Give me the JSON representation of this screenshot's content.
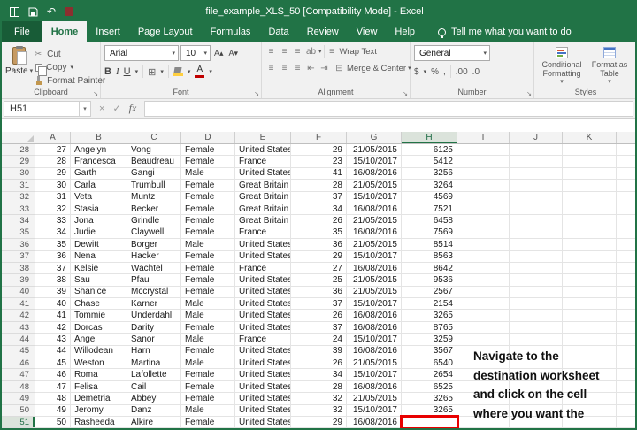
{
  "window": {
    "title": "file_example_XLS_50 [Compatibility Mode] - Excel"
  },
  "colors": {
    "titlebar_green": "#217346",
    "selection_box_red": "#e80000"
  },
  "icons": {
    "caret": "▾",
    "undo": "↶",
    "redo": "↷",
    "cut": "✂",
    "align": "≡",
    "borders": "⊞",
    "merge": "⊟",
    "cancel": "×",
    "enter": "✓",
    "fx": "fx",
    "launcher": "↘",
    "grow_font": "A▴",
    "shrink_font": "A▾",
    "font_color_letter": "A",
    "orientation": "ab",
    "indent_left": "⇤",
    "indent_right": "⇥"
  },
  "ribbon": {
    "tabs": [
      {
        "label": "File",
        "active": false
      },
      {
        "label": "Home",
        "active": true
      },
      {
        "label": "Insert",
        "active": false
      },
      {
        "label": "Page Layout",
        "active": false
      },
      {
        "label": "Formulas",
        "active": false
      },
      {
        "label": "Data",
        "active": false
      },
      {
        "label": "Review",
        "active": false
      },
      {
        "label": "View",
        "active": false
      },
      {
        "label": "Help",
        "active": false
      }
    ],
    "tell_me": "Tell me what you want to do",
    "clipboard": {
      "group_label": "Clipboard",
      "paste": "Paste",
      "cut": "Cut",
      "copy": "Copy",
      "format_painter": "Format Painter"
    },
    "font": {
      "group_label": "Font",
      "font_name": "Arial",
      "font_size": "10",
      "bold": "B",
      "italic": "I",
      "underline": "U"
    },
    "alignment": {
      "group_label": "Alignment",
      "wrap_text": "Wrap Text",
      "merge_center": "Merge & Center"
    },
    "number": {
      "group_label": "Number",
      "format": "General",
      "accounting": "$",
      "percent": "%",
      "comma": ",",
      "increase_decimal": ".00",
      "decrease_decimal": ".0"
    },
    "styles": {
      "group_label": "Styles",
      "conditional_formatting": "Conditional Formatting",
      "format_as_table": "Format as Table"
    }
  },
  "formula_bar": {
    "name_box": "H51",
    "formula": ""
  },
  "sheet": {
    "columns": [
      "A",
      "B",
      "C",
      "D",
      "E",
      "F",
      "G",
      "H",
      "I",
      "J",
      "K"
    ],
    "column_align": [
      "right",
      "left",
      "left",
      "left",
      "left",
      "right",
      "right",
      "right",
      "left",
      "left",
      "left"
    ],
    "selected": {
      "col": "H",
      "row": 51
    },
    "rows": [
      {
        "n": 28,
        "c": [
          "27",
          "Angelyn",
          "Vong",
          "Female",
          "United States",
          "29",
          "21/05/2015",
          "6125"
        ]
      },
      {
        "n": 29,
        "c": [
          "28",
          "Francesca",
          "Beaudreau",
          "Female",
          "France",
          "23",
          "15/10/2017",
          "5412"
        ]
      },
      {
        "n": 30,
        "c": [
          "29",
          "Garth",
          "Gangi",
          "Male",
          "United States",
          "41",
          "16/08/2016",
          "3256"
        ]
      },
      {
        "n": 31,
        "c": [
          "30",
          "Carla",
          "Trumbull",
          "Female",
          "Great Britain",
          "28",
          "21/05/2015",
          "3264"
        ]
      },
      {
        "n": 32,
        "c": [
          "31",
          "Veta",
          "Muntz",
          "Female",
          "Great Britain",
          "37",
          "15/10/2017",
          "4569"
        ]
      },
      {
        "n": 33,
        "c": [
          "32",
          "Stasia",
          "Becker",
          "Female",
          "Great Britain",
          "34",
          "16/08/2016",
          "7521"
        ]
      },
      {
        "n": 34,
        "c": [
          "33",
          "Jona",
          "Grindle",
          "Female",
          "Great Britain",
          "26",
          "21/05/2015",
          "6458"
        ]
      },
      {
        "n": 35,
        "c": [
          "34",
          "Judie",
          "Claywell",
          "Female",
          "France",
          "35",
          "16/08/2016",
          "7569"
        ]
      },
      {
        "n": 36,
        "c": [
          "35",
          "Dewitt",
          "Borger",
          "Male",
          "United States",
          "36",
          "21/05/2015",
          "8514"
        ]
      },
      {
        "n": 37,
        "c": [
          "36",
          "Nena",
          "Hacker",
          "Female",
          "United States",
          "29",
          "15/10/2017",
          "8563"
        ]
      },
      {
        "n": 38,
        "c": [
          "37",
          "Kelsie",
          "Wachtel",
          "Female",
          "France",
          "27",
          "16/08/2016",
          "8642"
        ]
      },
      {
        "n": 39,
        "c": [
          "38",
          "Sau",
          "Pfau",
          "Female",
          "United States",
          "25",
          "21/05/2015",
          "9536"
        ]
      },
      {
        "n": 40,
        "c": [
          "39",
          "Shanice",
          "Mccrystal",
          "Female",
          "United States",
          "36",
          "21/05/2015",
          "2567"
        ]
      },
      {
        "n": 41,
        "c": [
          "40",
          "Chase",
          "Karner",
          "Male",
          "United States",
          "37",
          "15/10/2017",
          "2154"
        ]
      },
      {
        "n": 42,
        "c": [
          "41",
          "Tommie",
          "Underdahl",
          "Male",
          "United States",
          "26",
          "16/08/2016",
          "3265"
        ]
      },
      {
        "n": 43,
        "c": [
          "42",
          "Dorcas",
          "Darity",
          "Female",
          "United States",
          "37",
          "16/08/2016",
          "8765"
        ]
      },
      {
        "n": 44,
        "c": [
          "43",
          "Angel",
          "Sanor",
          "Male",
          "France",
          "24",
          "15/10/2017",
          "3259"
        ]
      },
      {
        "n": 45,
        "c": [
          "44",
          "Willodean",
          "Harn",
          "Female",
          "United States",
          "39",
          "16/08/2016",
          "3567"
        ]
      },
      {
        "n": 46,
        "c": [
          "45",
          "Weston",
          "Martina",
          "Male",
          "United States",
          "26",
          "21/05/2015",
          "6540"
        ]
      },
      {
        "n": 47,
        "c": [
          "46",
          "Roma",
          "Lafollette",
          "Female",
          "United States",
          "34",
          "15/10/2017",
          "2654"
        ]
      },
      {
        "n": 48,
        "c": [
          "47",
          "Felisa",
          "Cail",
          "Female",
          "United States",
          "28",
          "16/08/2016",
          "6525"
        ]
      },
      {
        "n": 49,
        "c": [
          "48",
          "Demetria",
          "Abbey",
          "Female",
          "United States",
          "32",
          "21/05/2015",
          "3265"
        ]
      },
      {
        "n": 50,
        "c": [
          "49",
          "Jeromy",
          "Danz",
          "Male",
          "United States",
          "32",
          "15/10/2017",
          "3265"
        ]
      },
      {
        "n": 51,
        "c": [
          "50",
          "Rasheeda",
          "Alkire",
          "Female",
          "United States",
          "29",
          "16/08/2016",
          ""
        ]
      }
    ]
  },
  "overlay": {
    "lines": [
      "Navigate to the",
      "destination worksheet",
      "and click on the cell",
      "where you want the"
    ]
  }
}
